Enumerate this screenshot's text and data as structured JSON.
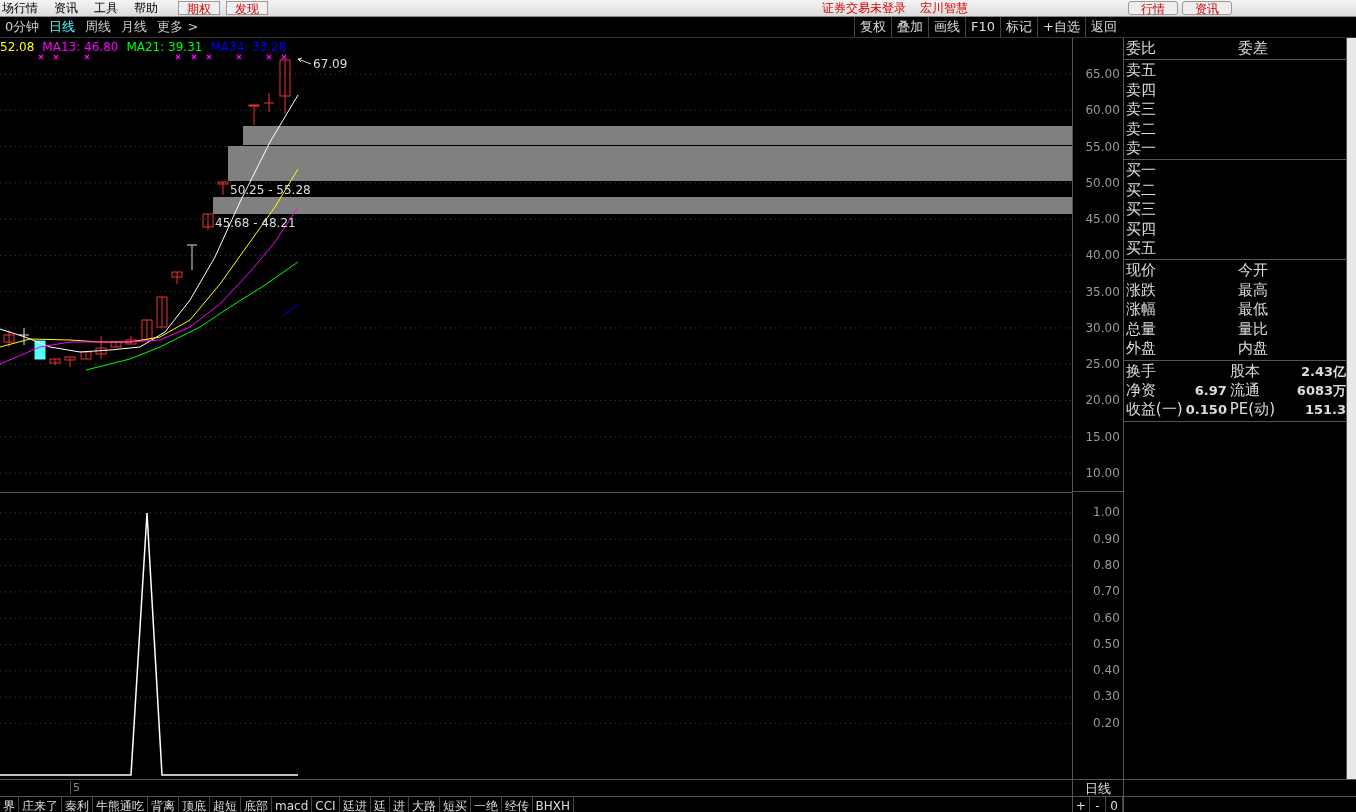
{
  "menu_bar": {
    "items": [
      "场行情",
      "资讯",
      "工具",
      "帮助"
    ],
    "buttons": [
      "期权",
      "发现"
    ],
    "status": [
      "证券交易未登录",
      "宏川智慧"
    ],
    "right_buttons": [
      "行情",
      "资讯"
    ]
  },
  "period_tabs": [
    {
      "label": "0分钟",
      "selected": false
    },
    {
      "label": "日线",
      "selected": true
    },
    {
      "label": "周线",
      "selected": false
    },
    {
      "label": "月线",
      "selected": false
    },
    {
      "label": "更多 >",
      "selected": false
    }
  ],
  "toolbar": [
    "复权",
    "叠加",
    "画线",
    "F10",
    "标记",
    "+自选",
    "返回"
  ],
  "legend": [
    {
      "text": "52.08",
      "color": "#ffff00"
    },
    {
      "text": "MA13: 46.80",
      "color": "#ff00ff"
    },
    {
      "text": "MA21: 39.31",
      "color": "#00ff00"
    },
    {
      "text": "MA34: 33.28",
      "color": "#0000ff"
    }
  ],
  "price_labels": {
    "high": "67.09",
    "zones": [
      "50.25 - 55.28",
      "45.68 - 48.21"
    ]
  },
  "price_axis": [
    "65.00",
    "60.00",
    "55.00",
    "50.00",
    "45.00",
    "40.00",
    "35.00",
    "30.00",
    "25.00",
    "20.00",
    "15.00",
    "10.00"
  ],
  "indicator_axis": [
    "1.00",
    "0.90",
    "0.80",
    "0.70",
    "0.60",
    "0.50",
    "0.40",
    "0.30",
    "0.20"
  ],
  "x_axis_label": "5",
  "axis_period": "日线",
  "zoom_buttons": [
    "+",
    "-",
    "0"
  ],
  "order_book": {
    "header": [
      "委比",
      "委差"
    ],
    "asks": [
      "卖五",
      "卖四",
      "卖三",
      "卖二",
      "卖一"
    ],
    "bids": [
      "买一",
      "买二",
      "买三",
      "买四",
      "买五"
    ]
  },
  "quote": [
    {
      "left": "现价",
      "right": "今开"
    },
    {
      "left": "涨跌",
      "right": "最高"
    },
    {
      "left": "涨幅",
      "right": "最低"
    },
    {
      "left": "总量",
      "right": "量比"
    },
    {
      "left": "外盘",
      "right": "内盘"
    }
  ],
  "fundamentals": [
    {
      "label1": "换手",
      "label2": "股本",
      "value2": "2.43亿"
    },
    {
      "label1": "净资",
      "value1": "6.97",
      "label2": "流通",
      "value2": "6083万"
    },
    {
      "label1": "收益(一)",
      "value1": "0.150",
      "label2": "PE(动)",
      "value2": "151.3"
    }
  ],
  "indicator_tabs": [
    "界",
    "庄来了",
    "秦利",
    "牛熊通吃",
    "背离",
    "顶底",
    "超短",
    "底部",
    "macd",
    "CCI",
    "廷进",
    "廷",
    "进",
    "大路",
    "短买",
    "一绝",
    "经传",
    "BHXH"
  ]
}
